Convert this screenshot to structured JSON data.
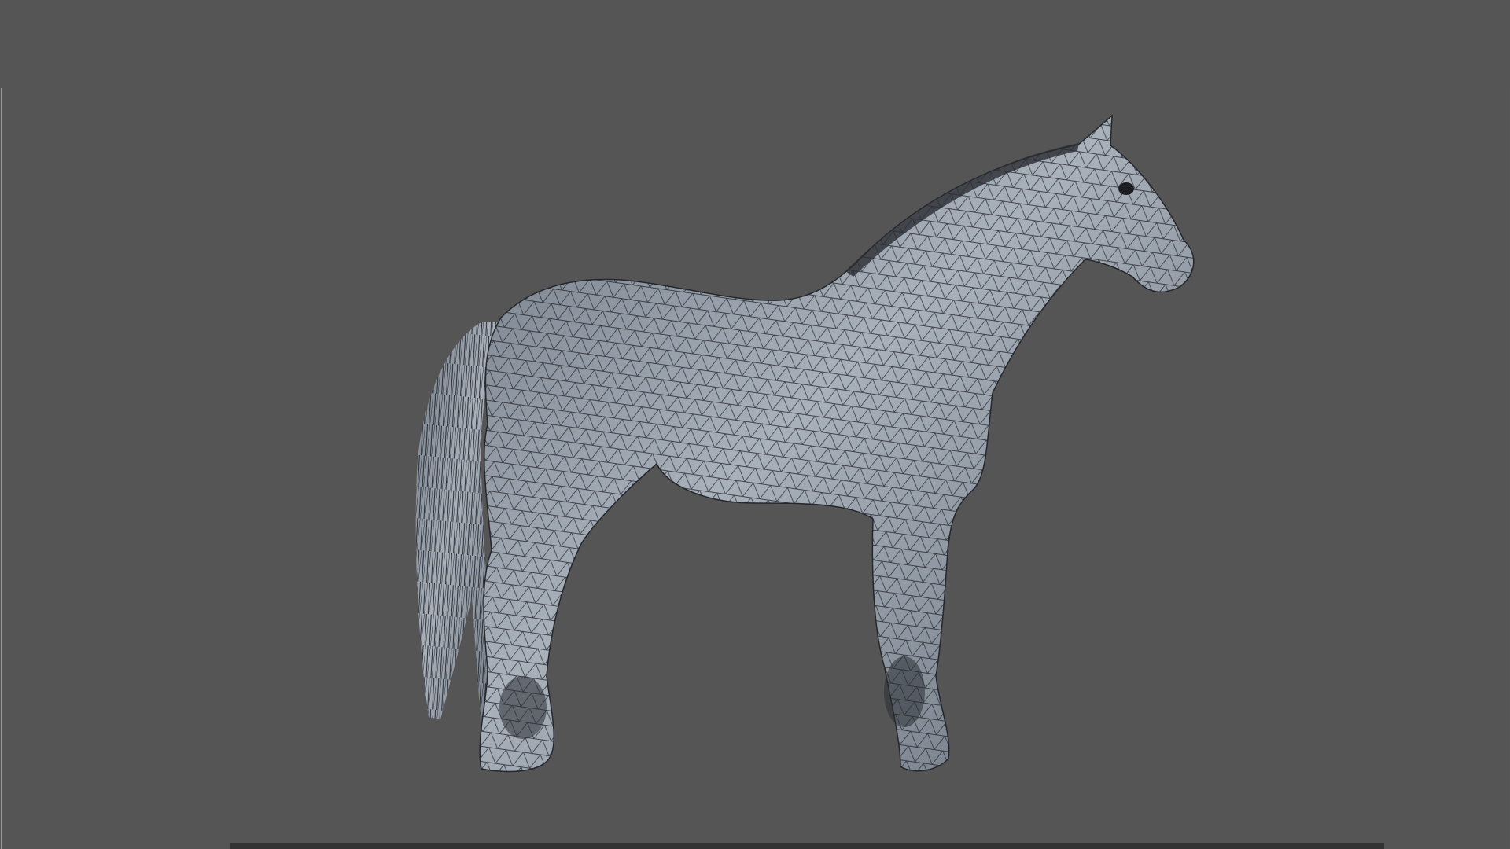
{
  "viewport": {
    "background_color": "#555555",
    "model_color": "#8e98a4",
    "wire_color": "#1e2126",
    "subject": "horse-wireframe-model"
  }
}
